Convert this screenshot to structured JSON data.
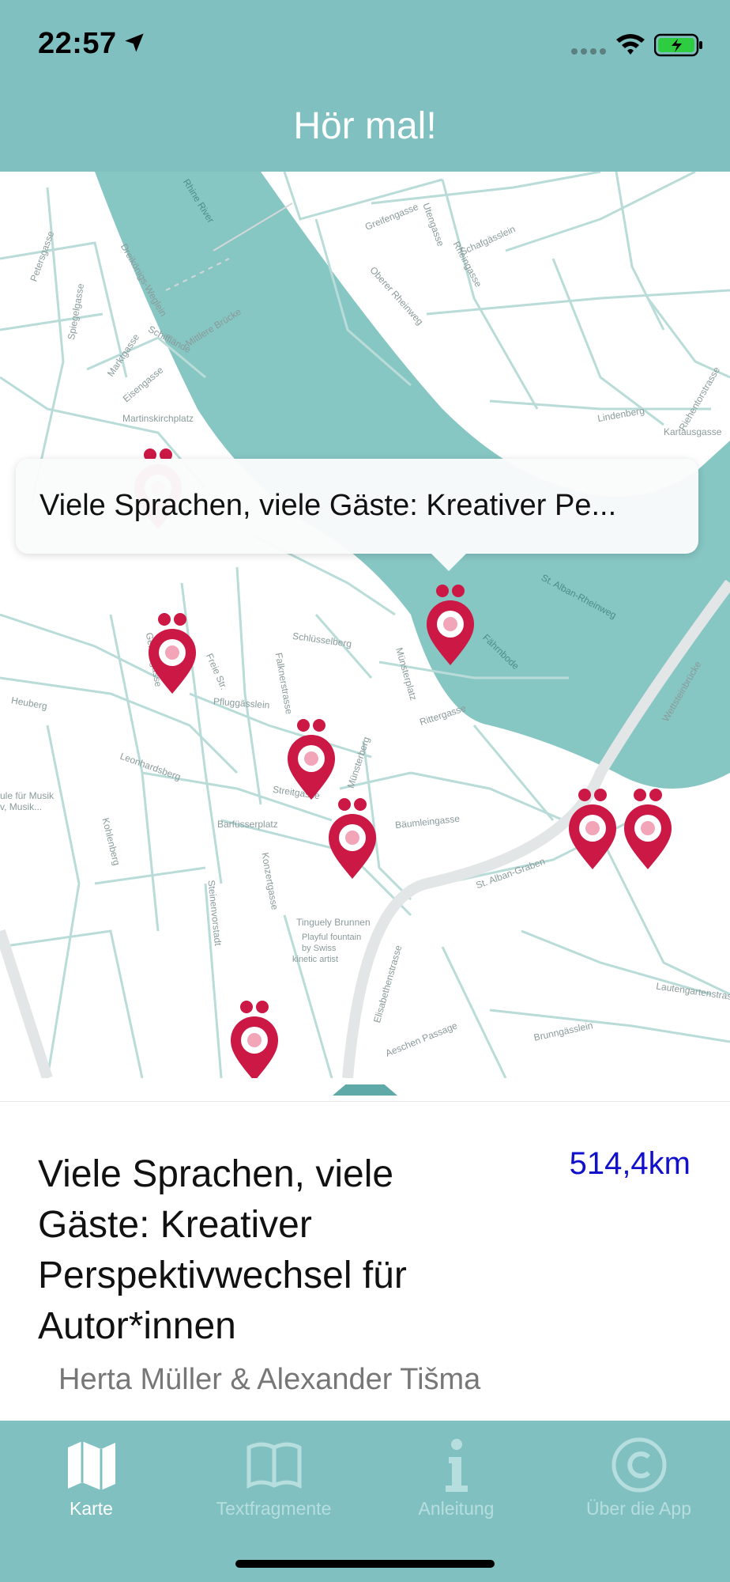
{
  "status_bar": {
    "time": "22:57"
  },
  "nav": {
    "title": "Hör mal!"
  },
  "map": {
    "water_color": "#86c6c3",
    "pin_color": "#cc1844",
    "labels": [
      "Rhine River",
      "Mittlere Brücke",
      "Schifflände",
      "Martinskirchplatz",
      "Rheingasse",
      "Oberer Rheinweg",
      "Schafgässlein",
      "Utengasse",
      "Greifengasse",
      "Riehentorstrasse",
      "Kartausgasse",
      "Lindenberg",
      "Barfüsserplatz",
      "Tinguely Brunnen",
      "Playful fountain",
      "by Swiss",
      "kinetic artist",
      "Elisabethenstrasse",
      "St. Alban-Graben",
      "Wettsteinbrücke",
      "Rittergasse",
      "Münsterplatz",
      "Pfluggässlein",
      "Leonhardsberg",
      "Heuberg",
      "Kohlenberg",
      "Steinenvorstadt",
      "Schlüsselberg",
      "Gerbergasse",
      "Bäumleingasse",
      "Aeschen Passage",
      "Brunngässlein",
      "Lautengartenstrasse",
      "Petersgasse",
      "Spiegelgasse",
      "Marktgasse",
      "Eisengasse",
      "Freie Str.",
      "Dreikönigs-Weglein",
      "Münsterberg",
      "Streitgasse",
      "Konzertgasse",
      "Falknerstrasse",
      "Fährnbode",
      "St. Alban-Rheinweg",
      "ule für Musik",
      "v, Musik..."
    ]
  },
  "callout": {
    "text": "Viele Sprachen, viele Gäste: Kreativer Pe..."
  },
  "detail": {
    "title": "Viele Sprachen, viele Gäste: Kreativer Perspektivwechsel für Autor*innen",
    "distance": "514,4km",
    "author": "Herta Müller & Alexander Tišma"
  },
  "tabs": [
    {
      "label": "Karte",
      "icon": "map-icon",
      "active": true
    },
    {
      "label": "Textfragmente",
      "icon": "book-icon",
      "active": false
    },
    {
      "label": "Anleitung",
      "icon": "info-icon",
      "active": false
    },
    {
      "label": "Über die App",
      "icon": "copyright-icon",
      "active": false
    }
  ],
  "colors": {
    "header": "#80c0c0",
    "tab_active": "#ffffff",
    "tab_inactive": "#b7dede",
    "distance": "#1111cc"
  }
}
